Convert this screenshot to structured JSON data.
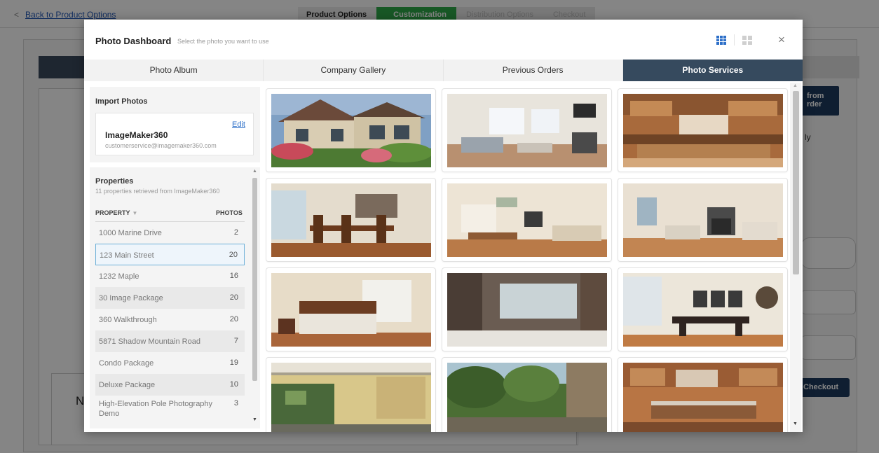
{
  "page": {
    "back_link": "Back to Product Options",
    "steps": [
      {
        "label": "Product Options",
        "state": "done"
      },
      {
        "label": "Customization",
        "state": "active"
      },
      {
        "label": "Distribution Options",
        "state": "upcoming"
      },
      {
        "label": "Checkout",
        "state": "upcoming"
      }
    ],
    "side_button": "from\nrder",
    "side_text": "ly",
    "checkout_button": "Checkout",
    "left_letter": "N"
  },
  "modal": {
    "title": "Photo Dashboard",
    "subtitle": "Select the photo you want to use",
    "view_grid_icon": "grid-small-icon",
    "view_tiles_icon": "grid-large-icon",
    "close_icon": "×",
    "tabs": [
      {
        "label": "Photo Album",
        "active": false
      },
      {
        "label": "Company Gallery",
        "active": false
      },
      {
        "label": "Previous Orders",
        "active": false
      },
      {
        "label": "Photo Services",
        "active": true
      }
    ]
  },
  "import": {
    "title": "Import Photos",
    "account_name": "ImageMaker360",
    "account_email": "customerservice@imagemaker360.com",
    "edit_label": "Edit"
  },
  "properties": {
    "title": "Properties",
    "subtitle": "11 properties retrieved from ImageMaker360",
    "col_property": "PROPERTY",
    "col_photos": "PHOTOS",
    "rows": [
      {
        "name": "1000 Marine Drive",
        "photos": "2"
      },
      {
        "name": "123 Main Street",
        "photos": "20",
        "selected": true
      },
      {
        "name": "1232 Maple",
        "photos": "16"
      },
      {
        "name": "30 Image Package",
        "photos": "20"
      },
      {
        "name": "360 Walkthrough",
        "photos": "20"
      },
      {
        "name": "5871 Shadow Mountain Road",
        "photos": "7"
      },
      {
        "name": "Condo Package",
        "photos": "19"
      },
      {
        "name": "Deluxe Package",
        "photos": "10"
      },
      {
        "name": "High-Elevation Pole Photography Demo",
        "photos": "3"
      }
    ]
  },
  "photos": [
    {
      "scene": "house-exterior"
    },
    {
      "scene": "living-room"
    },
    {
      "scene": "kitchen-wood"
    },
    {
      "scene": "dining-room"
    },
    {
      "scene": "living-dining"
    },
    {
      "scene": "living-fireplace"
    },
    {
      "scene": "bedroom"
    },
    {
      "scene": "bedroom-dark"
    },
    {
      "scene": "dining-dark-table"
    },
    {
      "scene": "patio-pergola"
    },
    {
      "scene": "garden"
    },
    {
      "scene": "kitchen-island"
    }
  ],
  "colors": {
    "accent_blue": "#2d6fc8",
    "tab_active": "#364a5e",
    "step_active": "#2faa4a",
    "navy_button": "#1e3a5f"
  }
}
